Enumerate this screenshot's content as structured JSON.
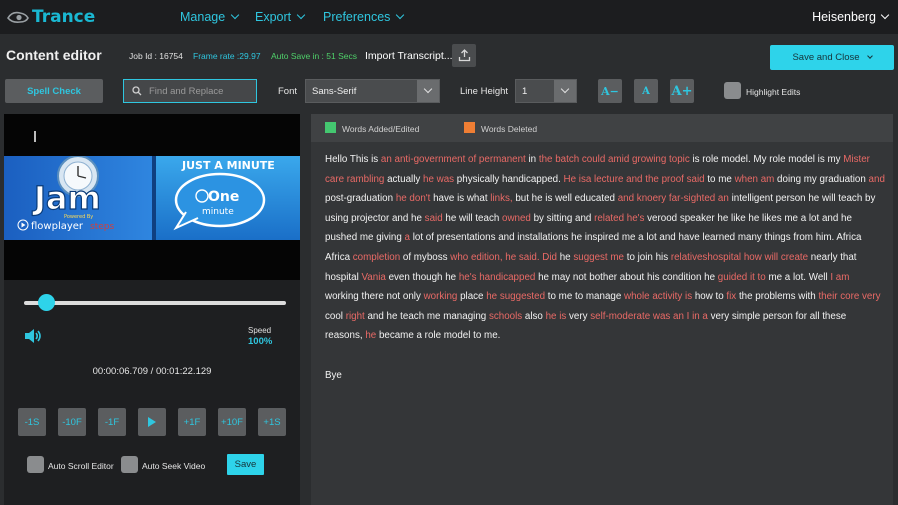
{
  "app": {
    "logo_text": "Trance",
    "user_name": "Heisenberg"
  },
  "nav": {
    "menus": [
      "Manage",
      "Export",
      "Preferences"
    ]
  },
  "header": {
    "title": "Content editor",
    "job_id": "Job Id : 16754",
    "frame_rate": "Frame rate :29.97",
    "auto_save": "Auto Save in : 51 Secs",
    "import_label": "Import Transcript...",
    "save_close_label": "Save and Close"
  },
  "toolbar": {
    "spell_check": "Spell Check",
    "find_placeholder": "Find and Replace",
    "font_label": "Font",
    "font_value": "Sans-Serif",
    "line_height_label": "Line Height",
    "line_height_value": "1",
    "font_smaller": "A−",
    "font_reset": "A",
    "font_larger": "A+",
    "highlight_edits": "Highlight Edits"
  },
  "player": {
    "thumbnail": {
      "left_title": "Jam",
      "powered_by": "Powered By",
      "right_banner": "JUST A MINUTE",
      "one": "One",
      "minute": "minute",
      "flowplayer": "flowplayer",
      "steps": "steps"
    },
    "progress": 0.087,
    "speed_label": "Speed",
    "speed_value": "100%",
    "time_display": "00:00:06.709 / 00:01:22.129",
    "controls": [
      "-1S",
      "-10F",
      "-1F",
      "",
      "+1F",
      "+10F",
      "+1S"
    ],
    "auto_scroll": "Auto Scroll Editor",
    "auto_seek": "Auto Seek Video",
    "save_label": "Save"
  },
  "legend": {
    "added": {
      "label": "Words Added/Edited",
      "color": "#44c770"
    },
    "deleted": {
      "label": "Words Deleted",
      "color": "#ef7e34"
    }
  },
  "colors": {
    "accent": "#2fc6df",
    "deleted_text": "#e96a66"
  },
  "transcript": {
    "segments": [
      {
        "t": "Hello This is ",
        "del": false
      },
      {
        "t": "an anti-government of permanent",
        "del": true
      },
      {
        "t": " in ",
        "del": false
      },
      {
        "t": "the batch could amid growing topic",
        "del": true
      },
      {
        "t": " is role model. My role model is my ",
        "del": false
      },
      {
        "t": "Mister care rambling",
        "del": true
      },
      {
        "t": " actually ",
        "del": false
      },
      {
        "t": "he was",
        "del": true
      },
      {
        "t": " physically handicapped. ",
        "del": false
      },
      {
        "t": "He isa lecture and the proof said",
        "del": true
      },
      {
        "t": " to me ",
        "del": false
      },
      {
        "t": "when am",
        "del": true
      },
      {
        "t": " doing my graduation ",
        "del": false
      },
      {
        "t": "and",
        "del": true
      },
      {
        "t": " post-graduation ",
        "del": false
      },
      {
        "t": "he don't",
        "del": true
      },
      {
        "t": " have is what ",
        "del": false
      },
      {
        "t": "links,",
        "del": true
      },
      {
        "t": " but he is well educated ",
        "del": false
      },
      {
        "t": "and knoery far-sighted an",
        "del": true
      },
      {
        "t": " intelligent person he will teach by using projector and he ",
        "del": false
      },
      {
        "t": "said",
        "del": true
      },
      {
        "t": " he will teach ",
        "del": false
      },
      {
        "t": "owned",
        "del": true
      },
      {
        "t": " by sitting and ",
        "del": false
      },
      {
        "t": "related he's",
        "del": true
      },
      {
        "t": " verood speaker he like he likes me a lot and he pushed me giving ",
        "del": false
      },
      {
        "t": "a",
        "del": true
      },
      {
        "t": " lot of presentations and installations he inspired me a lot and have learned many things from him. Africa Africa ",
        "del": false
      },
      {
        "t": "completion",
        "del": true
      },
      {
        "t": " of myboss ",
        "del": false
      },
      {
        "t": "who edition, he said. Did",
        "del": true
      },
      {
        "t": " he ",
        "del": false
      },
      {
        "t": "suggest me",
        "del": true
      },
      {
        "t": " to join his ",
        "del": false
      },
      {
        "t": "relativeshospital how will create",
        "del": true
      },
      {
        "t": " nearly that hospital ",
        "del": false
      },
      {
        "t": "Vania",
        "del": true
      },
      {
        "t": " even though he ",
        "del": false
      },
      {
        "t": "he's handicapped",
        "del": true
      },
      {
        "t": " he may not bother about his condition he ",
        "del": false
      },
      {
        "t": "guided it to",
        "del": true
      },
      {
        "t": " me a lot. Well ",
        "del": false
      },
      {
        "t": "I am",
        "del": true
      },
      {
        "t": " working there not only ",
        "del": false
      },
      {
        "t": "working",
        "del": true
      },
      {
        "t": " place ",
        "del": false
      },
      {
        "t": "he suggested",
        "del": true
      },
      {
        "t": " to me to manage ",
        "del": false
      },
      {
        "t": "whole activity is",
        "del": true
      },
      {
        "t": " how to ",
        "del": false
      },
      {
        "t": "fix",
        "del": true
      },
      {
        "t": " the problems with ",
        "del": false
      },
      {
        "t": "their core very",
        "del": true
      },
      {
        "t": " cool ",
        "del": false
      },
      {
        "t": "right",
        "del": true
      },
      {
        "t": " and he teach me managing ",
        "del": false
      },
      {
        "t": "schools",
        "del": true
      },
      {
        "t": " also ",
        "del": false
      },
      {
        "t": "he is",
        "del": true
      },
      {
        "t": " very ",
        "del": false
      },
      {
        "t": "self-moderate was an I in a",
        "del": true
      },
      {
        "t": " very simple person for all these reasons, ",
        "del": false
      },
      {
        "t": "he",
        "del": true
      },
      {
        "t": " became a role model to me.",
        "del": false
      }
    ],
    "closing": "Bye"
  }
}
